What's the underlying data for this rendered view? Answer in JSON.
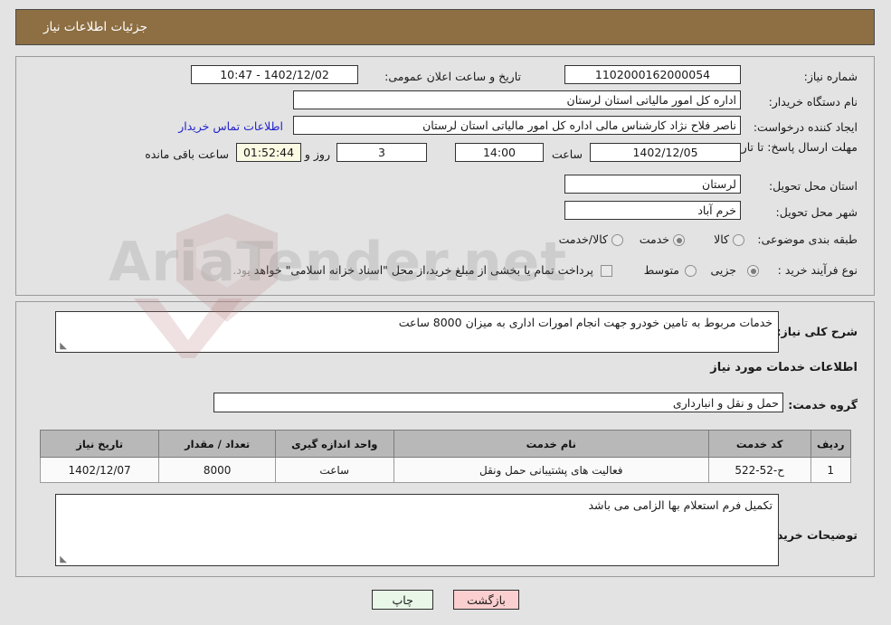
{
  "header": {
    "title": "جزئیات اطلاعات نیاز"
  },
  "need_info": {
    "need_number_label": "شماره نیاز:",
    "need_number_value": "1102000162000054",
    "announce_datetime_label": "تاریخ و ساعت اعلان عمومی:",
    "announce_datetime_value": "1402/12/02 - 10:47",
    "buyer_org_label": "نام دستگاه خریدار:",
    "buyer_org_value": "اداره کل امور مالیاتی استان لرستان",
    "creator_label": "ایجاد کننده درخواست:",
    "creator_value": "ناصر فلاح نژاد کارشناس مالی اداره کل امور مالیاتی استان لرستان",
    "contact_link": "اطلاعات تماس خریدار",
    "deadline_label": "مهلت ارسال پاسخ: تا تاریخ:",
    "deadline_date": "1402/12/05",
    "deadline_hour_label": "ساعت",
    "deadline_time": "14:00",
    "remaining_days": "3",
    "remaining_days_label": "روز و",
    "remaining_time": "01:52:44",
    "remaining_time_label": "ساعت باقی مانده",
    "delivery_province_label": "استان محل تحویل:",
    "delivery_province_value": "لرستان",
    "delivery_city_label": "شهر محل تحویل:",
    "delivery_city_value": "خرم آباد",
    "category_label": "طبقه بندی موضوعی:",
    "category_options": [
      {
        "label": "کالا",
        "selected": false
      },
      {
        "label": "خدمت",
        "selected": true
      },
      {
        "label": "کالا/خدمت",
        "selected": false
      }
    ],
    "process_type_label": "نوع فرآیند خرید :",
    "process_options": [
      {
        "label": "جزیی",
        "selected": true
      },
      {
        "label": "متوسط",
        "selected": false
      }
    ],
    "treasury_checkbox_label": "پرداخت تمام یا بخشی از مبلغ خرید،از محل \"اسناد خزانه اسلامی\" خواهد بود.",
    "treasury_checked": false
  },
  "description": {
    "label": "شرح کلی نیاز:",
    "value": "خدمات مربوط به تامین خودرو جهت انجام امورات اداری به میزان 8000 ساعت"
  },
  "services": {
    "section_title": "اطلاعات خدمات مورد نیاز",
    "group_label": "گروه خدمت:",
    "group_value": "حمل و نقل و انبارداری",
    "columns": [
      "ردیف",
      "کد خدمت",
      "نام خدمت",
      "واحد اندازه گیری",
      "تعداد / مقدار",
      "تاریخ نیاز"
    ],
    "rows": [
      {
        "row_no": "1",
        "service_code": "ح-52-522",
        "service_name": "فعالیت های پشتیبانی حمل ونقل",
        "unit": "ساعت",
        "quantity": "8000",
        "need_date": "1402/12/07"
      }
    ]
  },
  "buyer_notes": {
    "label": "توضیحات خریدار:",
    "value": "تکمیل فرم استعلام بها الزامی می باشد"
  },
  "buttons": {
    "print": "چاپ",
    "back": "بازگشت"
  },
  "watermark": {
    "text": "AriaTender.net",
    "top_text": "net"
  },
  "colors": {
    "header_brown": "#8d6f43",
    "page_bg": "#e3e3e3",
    "table_header": "#b8b8b8",
    "link_blue": "#2222cc",
    "countdown_bg": "#fbfae3",
    "print_btn": "#e8f7e8",
    "back_btn": "#fbcfcf"
  }
}
